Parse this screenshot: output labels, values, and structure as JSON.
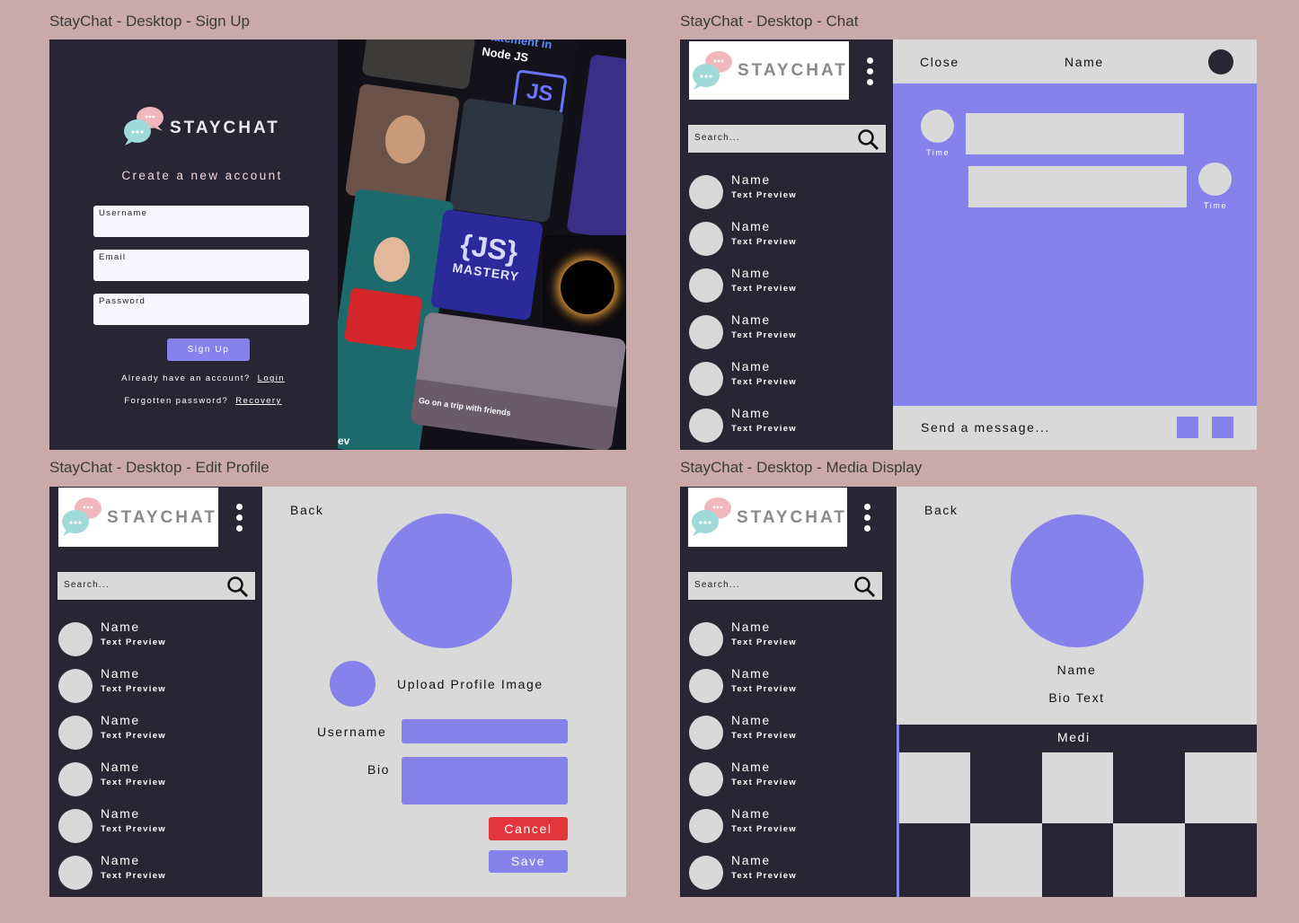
{
  "frames": {
    "signup": "StayChat - Desktop - Sign Up",
    "chat": "StayChat - Desktop - Chat",
    "edit": "StayChat - Desktop - Edit Profile",
    "media": "StayChat - Desktop - Media Display"
  },
  "brand": {
    "name": "STAYCHAT",
    "accent": "#8582ec",
    "dark": "#282634",
    "light": "#d9d9d9",
    "danger": "#e3363c"
  },
  "signup": {
    "heading": "Create a new account",
    "username_label": "Username",
    "email_label": "Email",
    "password_label": "Password",
    "button": "Sign Up",
    "have_account": "Already have an account?",
    "login_link": "Login",
    "forgot": "Forgotten password?",
    "recovery_link": "Recovery",
    "collage": {
      "statement": "Statement in",
      "node": "Node JS",
      "js_mastery": "{JS}",
      "mastery": "MASTERY",
      "trip": "Go on a trip with friends",
      "ev": "ev"
    }
  },
  "sidebar": {
    "search_placeholder": "Search...",
    "contacts": [
      {
        "name": "Name",
        "preview": "Text Preview"
      },
      {
        "name": "Name",
        "preview": "Text Preview"
      },
      {
        "name": "Name",
        "preview": "Text Preview"
      },
      {
        "name": "Name",
        "preview": "Text Preview"
      },
      {
        "name": "Name",
        "preview": "Text Preview"
      },
      {
        "name": "Name",
        "preview": "Text Preview"
      }
    ]
  },
  "chat": {
    "close": "Close",
    "name": "Name",
    "time_left": "Time",
    "time_right": "Time",
    "composer_placeholder": "Send a message..."
  },
  "edit": {
    "back": "Back",
    "upload": "Upload Profile Image",
    "username_label": "Username",
    "bio_label": "Bio",
    "cancel": "Cancel",
    "save": "Save"
  },
  "media": {
    "back": "Back",
    "name": "Name",
    "bio": "Bio Text",
    "media_header": "Medi"
  }
}
